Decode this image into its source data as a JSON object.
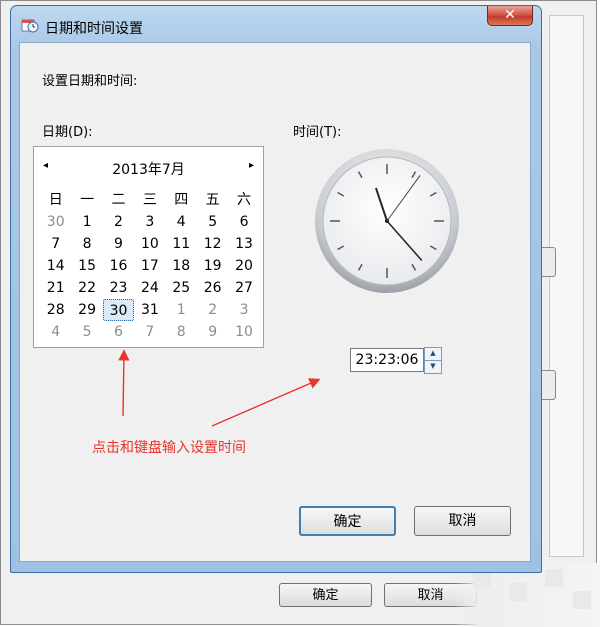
{
  "dialog": {
    "title": "日期和时间设置",
    "close_label": "✕",
    "heading": "设置日期和时间:",
    "date_label": "日期(D):",
    "time_label": "时间(T):",
    "ok_label": "确定",
    "cancel_label": "取消"
  },
  "calendar": {
    "month_label": "2013年7月",
    "prev_icon": "◂",
    "next_icon": "▸",
    "weekdays": [
      "日",
      "一",
      "二",
      "三",
      "四",
      "五",
      "六"
    ],
    "weeks": [
      [
        {
          "d": "30",
          "o": true
        },
        {
          "d": "1"
        },
        {
          "d": "2"
        },
        {
          "d": "3"
        },
        {
          "d": "4"
        },
        {
          "d": "5"
        },
        {
          "d": "6"
        }
      ],
      [
        {
          "d": "7"
        },
        {
          "d": "8"
        },
        {
          "d": "9"
        },
        {
          "d": "10"
        },
        {
          "d": "11"
        },
        {
          "d": "12"
        },
        {
          "d": "13"
        }
      ],
      [
        {
          "d": "14"
        },
        {
          "d": "15"
        },
        {
          "d": "16"
        },
        {
          "d": "17"
        },
        {
          "d": "18"
        },
        {
          "d": "19"
        },
        {
          "d": "20"
        }
      ],
      [
        {
          "d": "21"
        },
        {
          "d": "22"
        },
        {
          "d": "23"
        },
        {
          "d": "24"
        },
        {
          "d": "25"
        },
        {
          "d": "26"
        },
        {
          "d": "27"
        }
      ],
      [
        {
          "d": "28"
        },
        {
          "d": "29"
        },
        {
          "d": "30",
          "sel": true
        },
        {
          "d": "31"
        },
        {
          "d": "1",
          "o": true
        },
        {
          "d": "2",
          "o": true
        },
        {
          "d": "3",
          "o": true
        }
      ],
      [
        {
          "d": "4",
          "o": true
        },
        {
          "d": "5",
          "o": true
        },
        {
          "d": "6",
          "o": true
        },
        {
          "d": "7",
          "o": true
        },
        {
          "d": "8",
          "o": true
        },
        {
          "d": "9",
          "o": true
        },
        {
          "d": "10",
          "o": true
        }
      ]
    ]
  },
  "clock": {
    "hour": 23,
    "minute": 23,
    "second": 6
  },
  "time_field": {
    "value": "23:23:06",
    "up_icon": "▲",
    "down_icon": "▼"
  },
  "annotation": {
    "text": "点击和键盘输入设置时间",
    "color": "#e8362a"
  },
  "background_window": {
    "ok_label": "确定",
    "cancel_label": "取消"
  },
  "colors": {
    "title_bar": "#aac8e6",
    "close_button": "#c23a29",
    "selected_day": "#dbeaf9"
  }
}
